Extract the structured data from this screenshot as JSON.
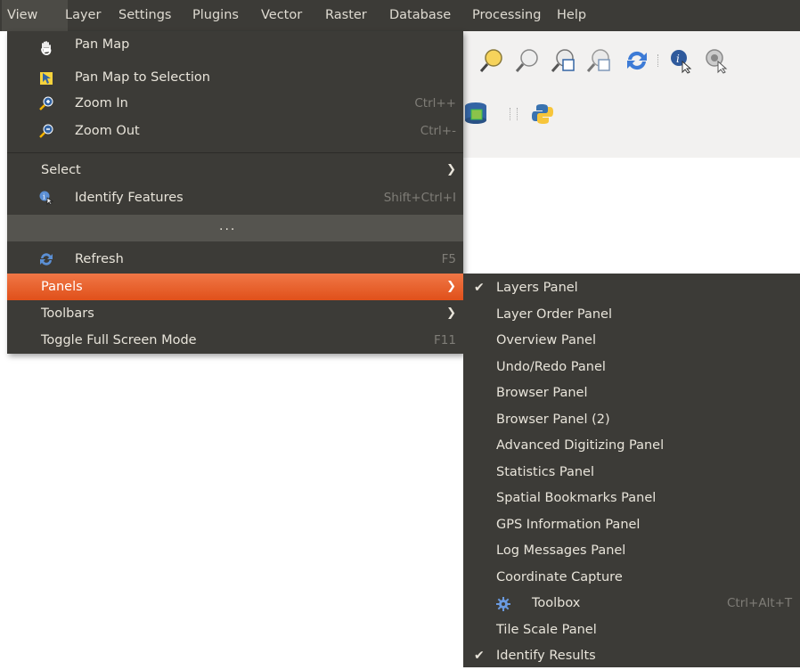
{
  "menubar": {
    "items": [
      {
        "label": "View"
      },
      {
        "label": "Layer"
      },
      {
        "label": "Settings"
      },
      {
        "label": "Plugins"
      },
      {
        "label": "Vector"
      },
      {
        "label": "Raster"
      },
      {
        "label": "Database"
      },
      {
        "label": "Processing"
      },
      {
        "label": "Help"
      }
    ]
  },
  "view_menu": {
    "items": [
      {
        "label": "Pan Map",
        "shortcut": "",
        "icon": "pan-hand-icon"
      },
      {
        "label": "Pan Map to Selection",
        "shortcut": "",
        "icon": "pan-selection-icon"
      },
      {
        "label": "Zoom In",
        "shortcut": "Ctrl++",
        "icon": "zoom-in-icon"
      },
      {
        "label": "Zoom Out",
        "shortcut": "Ctrl+-",
        "icon": "zoom-out-icon"
      },
      {
        "label": "Select",
        "submenu": true
      },
      {
        "label": "Identify Features",
        "shortcut": "Shift+Ctrl+I",
        "icon": "identify-icon"
      },
      {
        "label": "Refresh",
        "shortcut": "F5",
        "icon": "refresh-icon"
      },
      {
        "label": "Panels",
        "submenu": true,
        "highlighted": true
      },
      {
        "label": "Toolbars",
        "submenu": true
      },
      {
        "label": "Toggle Full Screen Mode",
        "shortcut": "F11"
      }
    ],
    "overflow_label": "..."
  },
  "panels_submenu": {
    "items": [
      {
        "label": "Layers Panel",
        "checked": true
      },
      {
        "label": "Layer Order Panel",
        "checked": false
      },
      {
        "label": "Overview Panel",
        "checked": false
      },
      {
        "label": "Undo/Redo Panel",
        "checked": false
      },
      {
        "label": "Browser Panel",
        "checked": false
      },
      {
        "label": "Browser Panel (2)",
        "checked": false
      },
      {
        "label": "Advanced Digitizing Panel",
        "checked": false
      },
      {
        "label": "Statistics Panel",
        "checked": false
      },
      {
        "label": "Spatial Bookmarks Panel",
        "checked": false
      },
      {
        "label": "GPS Information Panel",
        "checked": false
      },
      {
        "label": "Log Messages Panel",
        "checked": false
      },
      {
        "label": "Coordinate Capture",
        "checked": false
      },
      {
        "label": "Toolbox",
        "checked": false,
        "shortcut": "Ctrl+Alt+T",
        "icon": "gear-icon"
      },
      {
        "label": "Tile Scale Panel",
        "checked": false
      },
      {
        "label": "Identify Results",
        "checked": true
      }
    ],
    "check_glyph": "✔"
  },
  "colors": {
    "menu_bg": "#3c3b37",
    "highlight": "#e95420",
    "text": "#e8e4da",
    "shortcut_text": "#7f7d77"
  }
}
